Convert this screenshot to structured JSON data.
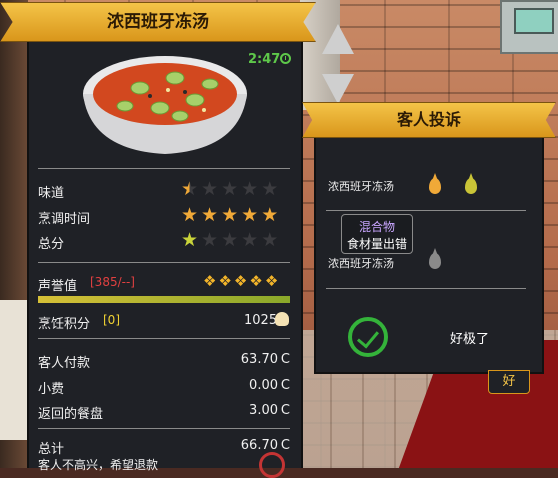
{
  "review": {
    "dish_title": "浓西班牙冻汤",
    "timer": "2:47",
    "rows": [
      {
        "label": "味道",
        "rating": 1.5,
        "max": 5,
        "color": "#f0a938"
      },
      {
        "label": "烹调时间",
        "rating": 5,
        "max": 5,
        "color": "#f0a938"
      },
      {
        "label": "总分",
        "rating": 1,
        "max": 5,
        "color": "#c9d43a"
      }
    ],
    "reputation": {
      "label": "声誉值",
      "value": "[385/--]",
      "progress": 1.0
    },
    "cooking_points": {
      "label": "烹饪积分",
      "bracket": "[0]",
      "value": "1025"
    },
    "payments": [
      {
        "label": "客人付款",
        "amount": "63.70"
      },
      {
        "label": "小费",
        "amount": "0.00"
      },
      {
        "label": "返回的餐盘",
        "amount": "3.00"
      }
    ],
    "currency_symbol": "C",
    "total": {
      "label": "总计",
      "amount": "66.70"
    },
    "unhappy_text": "客人不高兴，希望退款"
  },
  "complaint": {
    "title": "客人投诉",
    "items": [
      {
        "dish": "浓西班牙冻汤",
        "icons": [
          "oil-drop-icon",
          "oil-drop-icon"
        ]
      },
      {
        "dish": "浓西班牙冻汤",
        "tag_type": "混合物",
        "tag_text": "食材量出错",
        "icons": [
          "oil-drop-icon"
        ]
      }
    ],
    "verdict": "好极了",
    "ok_label": "好"
  },
  "colors": {
    "gold": "#f0a938",
    "green": "#c9d43a",
    "accent": "#f4c448",
    "check": "#34b33a",
    "danger": "#c43434"
  }
}
